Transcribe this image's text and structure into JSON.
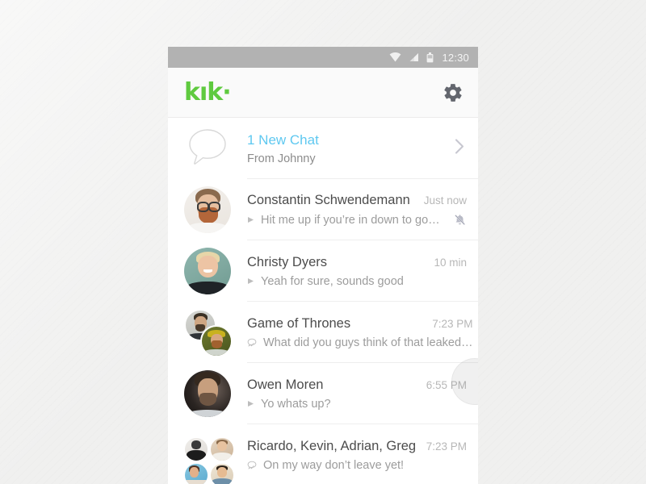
{
  "statusbar": {
    "time": "12:30",
    "icons": [
      "wifi-icon",
      "signal-icon",
      "battery-icon"
    ]
  },
  "appbar": {
    "logo_text": "kık",
    "logo_dot": "·",
    "logo_color": "#5fca3f",
    "settings_icon": "gear-icon"
  },
  "new_chat": {
    "title": "1 New Chat",
    "subtitle": "From Johnny",
    "title_color": "#5ec8f0",
    "avatar_icon": "speech-bubble-icon",
    "chevron_icon": "chevron-right-icon"
  },
  "conversations": [
    {
      "name": "Constantin Schwendemann",
      "time": "Just now",
      "preview": "Hit me up if you’re in down to go…",
      "status_icon": "sent-arrow-icon",
      "muted": true,
      "mute_icon": "bell-muted-icon",
      "avatar": "constantin"
    },
    {
      "name": "Christy Dyers",
      "time": "10 min",
      "preview": "Yeah for sure, sounds good",
      "status_icon": "sent-arrow-icon",
      "muted": false,
      "avatar": "christy"
    },
    {
      "name": "Game of Thrones",
      "time": "7:23 PM",
      "preview": "What did you guys think of that leaked…",
      "status_icon": "group-read-icon",
      "muted": false,
      "avatar": "got"
    },
    {
      "name": "Owen Moren",
      "time": "6:55 PM",
      "preview": "Yo whats up?",
      "status_icon": "sent-arrow-icon",
      "muted": false,
      "avatar": "owen"
    },
    {
      "name": "Ricardo, Kevin, Adrian, Greg",
      "time": "7:23 PM",
      "preview": "On my way don’t leave yet!",
      "status_icon": "group-read-icon",
      "muted": false,
      "avatar": "group"
    }
  ]
}
